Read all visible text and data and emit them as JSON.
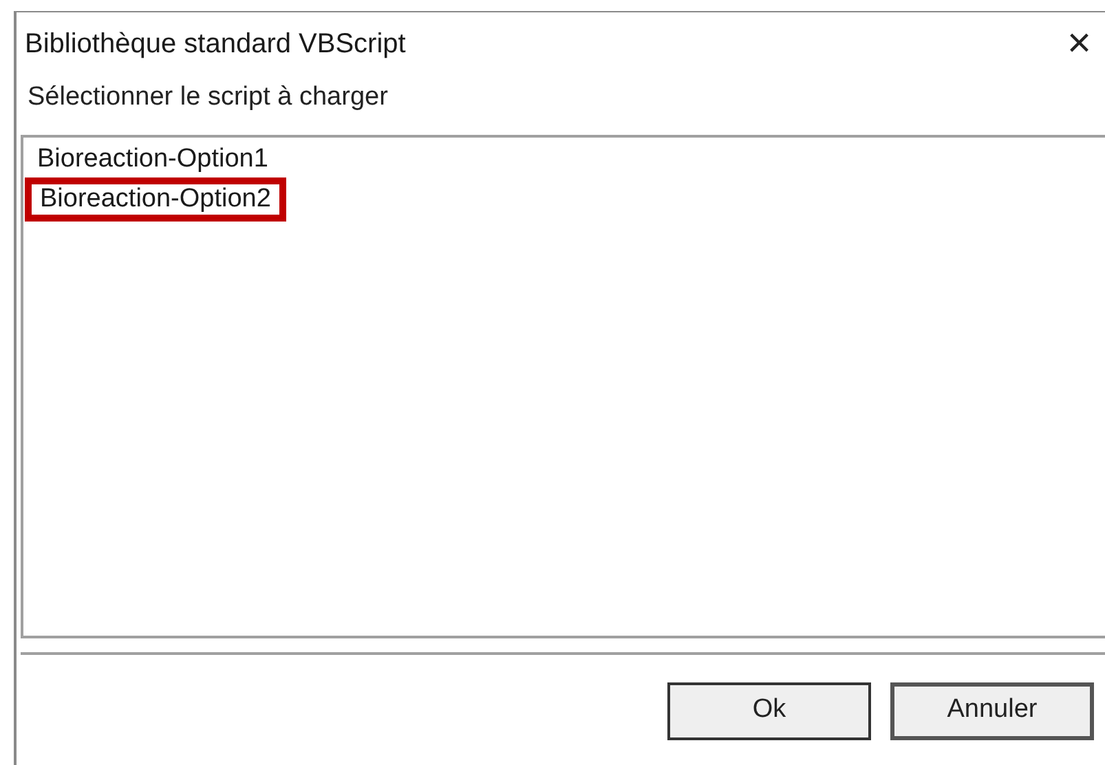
{
  "window": {
    "title": "Bibliothèque standard VBScript",
    "close": "×"
  },
  "prompt": "Sélectionner le script à charger",
  "scripts": [
    {
      "label": "Bioreaction-Option1",
      "highlighted": false
    },
    {
      "label": "Bioreaction-Option2",
      "highlighted": true
    }
  ],
  "buttons": [
    {
      "label": "Ok",
      "default": true
    },
    {
      "label": "Annuler",
      "default": false
    }
  ]
}
